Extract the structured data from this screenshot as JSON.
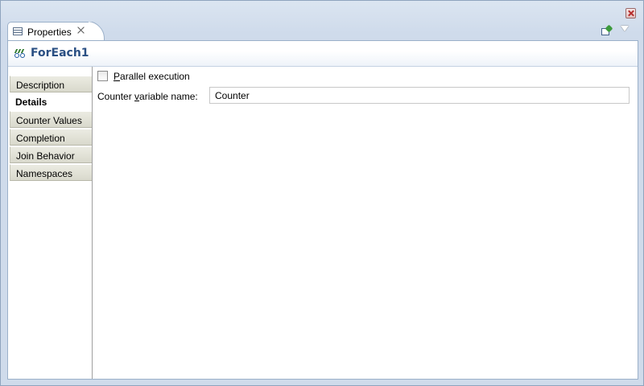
{
  "view": {
    "tab_title": "Properties",
    "tab_close_icon": "close-icon",
    "pin_icon": "pin-icon",
    "menu_icon": "view-menu-icon"
  },
  "header": {
    "title": "ForEach1",
    "icon": "foreach-icon"
  },
  "side_tabs": [
    {
      "label": "Description",
      "selected": false
    },
    {
      "label": "Details",
      "selected": true
    },
    {
      "label": "Counter Values",
      "selected": false
    },
    {
      "label": "Completion",
      "selected": false
    },
    {
      "label": "Join Behavior",
      "selected": false
    },
    {
      "label": "Namespaces",
      "selected": false
    }
  ],
  "details": {
    "parallel_label_mnemonic": "P",
    "parallel_label_rest": "arallel execution",
    "parallel_checked": false,
    "counter_label_pre": "Counter ",
    "counter_label_mnemonic": "v",
    "counter_label_post": "ariable name:",
    "counter_value": "Counter"
  },
  "colors": {
    "title": "#2a4f83",
    "panel_border": "#9bb0c9",
    "chrome_background": "#cfdbeb"
  }
}
